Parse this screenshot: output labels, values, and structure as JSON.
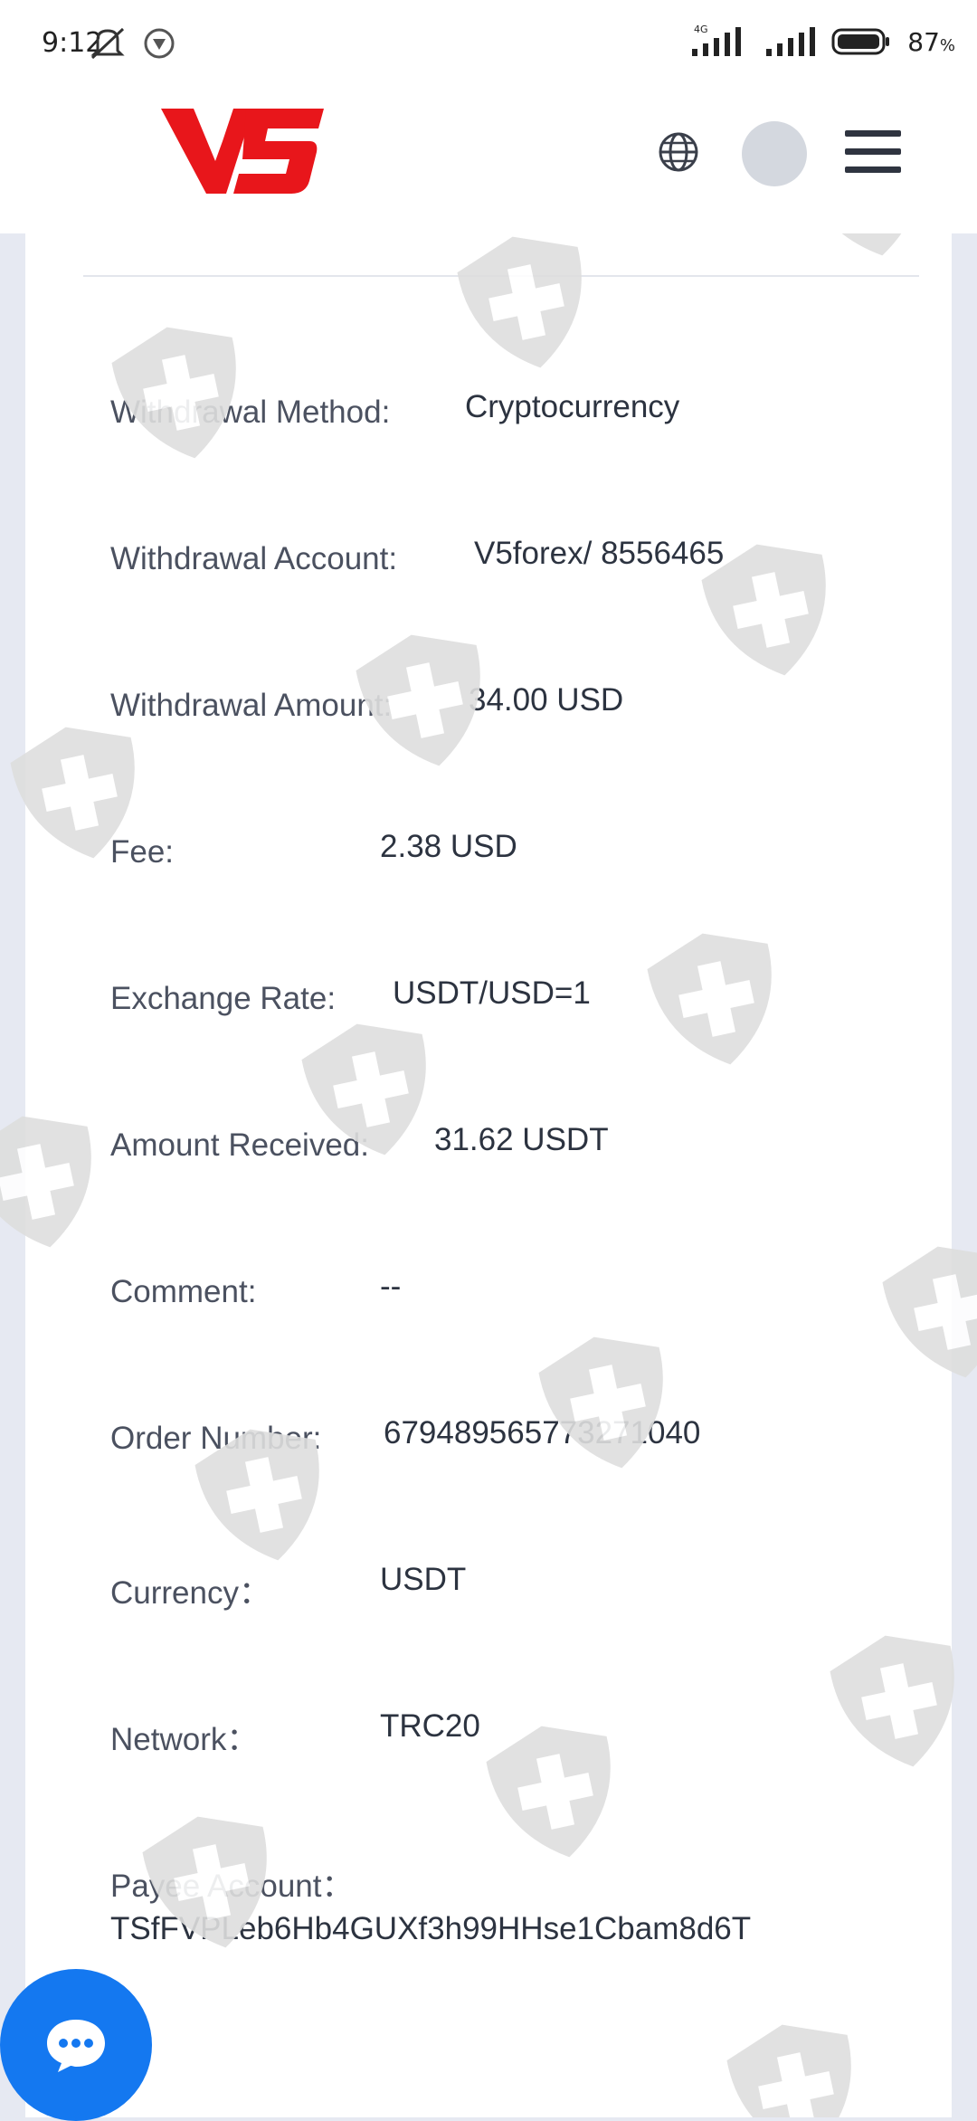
{
  "status_bar": {
    "time": "9:12",
    "network": "4G",
    "battery": "87",
    "battery_unit": "%"
  },
  "header": {
    "logo_text": "V5",
    "icons": [
      "globe-icon",
      "avatar",
      "menu-icon"
    ]
  },
  "details": [
    {
      "label": "Withdrawal Method:",
      "value": "Cryptocurrency"
    },
    {
      "label": "Withdrawal Account:",
      "value": "V5forex/ 8556465"
    },
    {
      "label": "Withdrawal Amount:",
      "value": "34.00 USD"
    },
    {
      "label": "Fee:",
      "value": "2.38 USD"
    },
    {
      "label": "Exchange Rate:",
      "value": "USDT/USD=1"
    },
    {
      "label": "Amount Received:",
      "value": "31.62 USDT"
    },
    {
      "label": "Comment:",
      "value": "--"
    },
    {
      "label": "Order Number:",
      "value": "679489565773271040"
    },
    {
      "label": "Currency：",
      "value": "USDT"
    },
    {
      "label": "Network：",
      "value": "TRC20"
    }
  ],
  "payee": {
    "label": "Payee Account：",
    "value": "TSfFVPLeb6Hb4GUXf3h99HHse1Cbam8d6T"
  },
  "colors": {
    "brand_red": "#e8161b",
    "chat_blue": "#1478f0",
    "background": "#e6e9f2"
  }
}
